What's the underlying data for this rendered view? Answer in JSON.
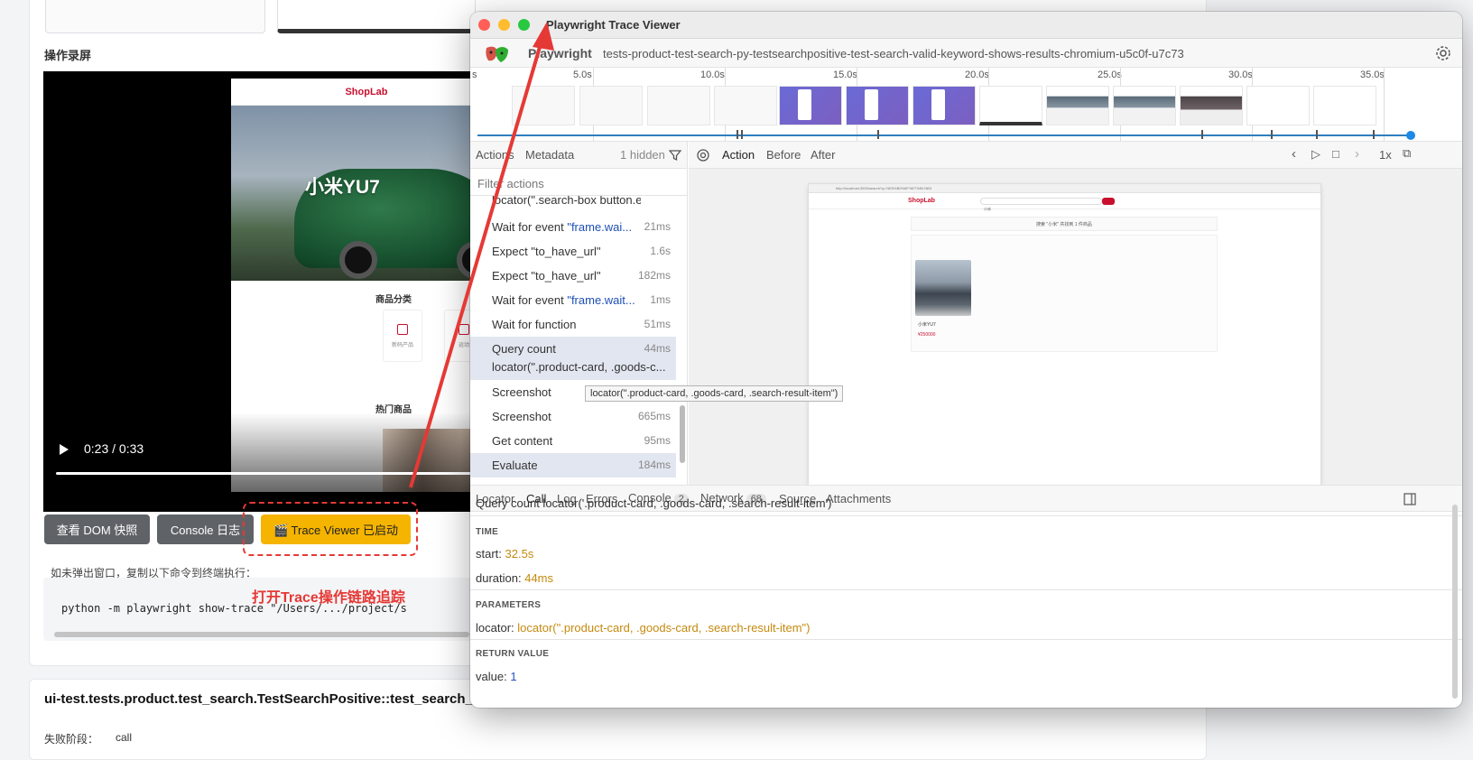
{
  "report": {
    "recording_title": "操作录屏",
    "video": {
      "shop_logo": "ShopLab",
      "hero_title": "小米YU7",
      "section_category": "商品分类",
      "section_hot": "热门商品",
      "category_items": [
        "新码产品",
        "运动"
      ],
      "time": "0:23 / 0:33"
    },
    "buttons": {
      "dom_snapshot": "查看 DOM 快照",
      "console_log": "Console 日志",
      "trace_viewer": "🎬 Trace Viewer 已启动"
    },
    "hint": "如未弹出窗口，复制以下命令到终端执行：",
    "command": "python -m playwright show-trace \"/Users/.../project/s",
    "failure": {
      "title": "ui-test.tests.product.test_search.TestSearchPositive::test_search_valid_keyword_shows_results[chromium-\\u024b\\u8868]",
      "stage_key": "失败阶段：",
      "stage_value": "call"
    }
  },
  "annotation": "打开Trace操作链路追踪",
  "trace_viewer": {
    "window_title": "Playwright Trace Viewer",
    "app_name": "Playwright",
    "trace_name": "tests-product-test-search-py-testsearchpositive-test-search-valid-keyword-shows-results-chromium-u5c0f-u7c73",
    "ticks": [
      "s",
      "5.0s",
      "10.0s",
      "15.0s",
      "20.0s",
      "25.0s",
      "30.0s",
      "35.0s"
    ],
    "left_tabs": {
      "actions": "Actions",
      "metadata": "Metadata",
      "hidden": "1 hidden"
    },
    "filter_placeholder": "Filter actions",
    "actions": [
      {
        "label": "locator(\".search-box button.el-b...",
        "time": ""
      },
      {
        "label": "Wait for event ",
        "label_blue": "\"frame.wai...",
        "time": "21ms"
      },
      {
        "label": "Expect \"to_have_url\"",
        "time": "1.6s"
      },
      {
        "label": "Expect \"to_have_url\"",
        "time": "182ms"
      },
      {
        "label": "Wait for event ",
        "label_blue": "\"frame.wait...",
        "time": "1ms"
      },
      {
        "label": "Wait for function",
        "time": "51ms"
      },
      {
        "label": "Query count",
        "time": "44ms",
        "sub": "locator(\".product-card, .goods-c..."
      },
      {
        "label": "Screenshot",
        "time": ""
      },
      {
        "label": "Screenshot",
        "time": "665ms"
      },
      {
        "label": "Get content",
        "time": "95ms"
      },
      {
        "label": "Evaluate",
        "time": "184ms"
      }
    ],
    "tooltip": "locator(\".product-card, .goods-card, .search-result-item\")",
    "right_tabs": {
      "action": "Action",
      "before": "Before",
      "after": "After",
      "speed": "1x"
    },
    "snapshot": {
      "url": "http://localhost:3000/search?q=%E5%B0%8F%E7%B1%B3",
      "logo": "ShopLab",
      "search_text": "小米",
      "result_text": "搜索 \"小米\" 共找到 1 件商品",
      "product_name": "小米YU7",
      "price": "¥250000"
    },
    "bottom_tabs": {
      "locator": "Locator",
      "call": "Call",
      "log": "Log",
      "errors": "Errors",
      "console": "Console",
      "console_count": "2",
      "network": "Network",
      "network_count": "68",
      "source": "Source",
      "attachments": "Attachments"
    },
    "call": {
      "title": "Query count locator('.product-card, .goods-card, .search-result-item')",
      "time_header": "TIME",
      "start_key": "start:",
      "start_val": "32.5s",
      "duration_key": "duration:",
      "duration_val": "44ms",
      "params_header": "PARAMETERS",
      "locator_key": "locator:",
      "locator_val": "locator(\".product-card, .goods-card, .search-result-item\")",
      "return_header": "RETURN VALUE",
      "value_key": "value:",
      "value_val": "1"
    },
    "colors": {
      "close": "#ff5f57",
      "minimize": "#febc2e",
      "zoom": "#28c840",
      "accent": "#2f7fbf"
    }
  }
}
